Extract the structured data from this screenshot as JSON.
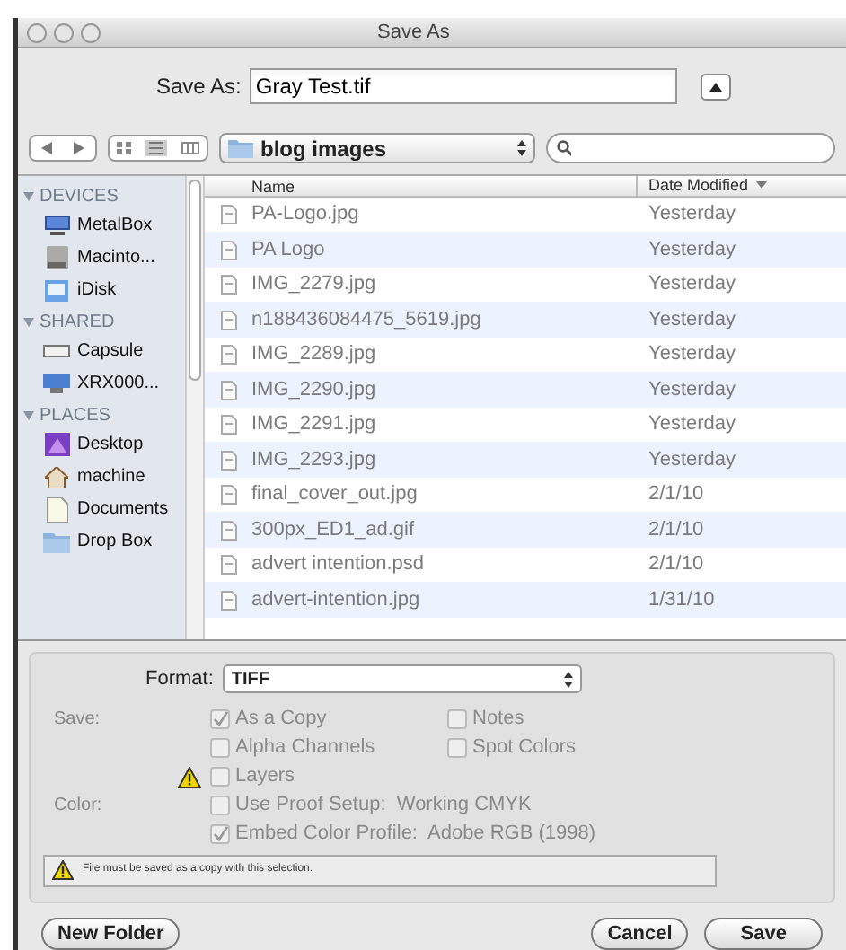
{
  "window": {
    "title": "Save As"
  },
  "save_as": {
    "label": "Save As:",
    "value": "Gray Test.tif",
    "expanded": false
  },
  "toolbar": {
    "location": "blog images"
  },
  "sidebar": [
    {
      "heading": "DEVICES",
      "expanded": true,
      "items": [
        {
          "label": "MetalBox"
        },
        {
          "label": "Macinto..."
        },
        {
          "label": "iDisk"
        }
      ]
    },
    {
      "heading": "SHARED",
      "expanded": true,
      "items": [
        {
          "label": "Capsule"
        },
        {
          "label": "XRX000..."
        }
      ]
    },
    {
      "heading": "PLACES",
      "expanded": true,
      "items": [
        {
          "label": "Desktop"
        },
        {
          "label": "machine"
        },
        {
          "label": "Documents"
        },
        {
          "label": "Drop Box"
        }
      ]
    }
  ],
  "table": {
    "columns": [
      "Name",
      "Date Modified"
    ],
    "rows": [
      {
        "name": "PA-Logo.jpg",
        "date": "Yesterday"
      },
      {
        "name": "PA Logo",
        "date": "Yesterday"
      },
      {
        "name": "IMG_2279.jpg",
        "date": "Yesterday"
      },
      {
        "name": "n188436084475_5619.jpg",
        "date": "Yesterday"
      },
      {
        "name": "IMG_2289.jpg",
        "date": "Yesterday"
      },
      {
        "name": "IMG_2290.jpg",
        "date": "Yesterday"
      },
      {
        "name": "IMG_2291.jpg",
        "date": "Yesterday"
      },
      {
        "name": "IMG_2293.jpg",
        "date": "Yesterday"
      },
      {
        "name": "final_cover_out.jpg",
        "date": "2/1/10"
      },
      {
        "name": "300px_ED1_ad.gif",
        "date": "2/1/10"
      },
      {
        "name": "advert intention.psd",
        "date": "2/1/10"
      },
      {
        "name": "advert-intention.jpg",
        "date": "1/31/10"
      }
    ]
  },
  "format": {
    "label": "Format:",
    "value": "TIFF"
  },
  "save_options": {
    "label": "Save:",
    "rows": [
      [
        {
          "label": "As a Copy",
          "checked": true,
          "warning": false
        },
        {
          "label": "Notes",
          "checked": false,
          "warning": false
        }
      ],
      [
        {
          "label": "Alpha Channels",
          "checked": false,
          "warning": false
        },
        {
          "label": "Spot Colors",
          "checked": false,
          "warning": false
        }
      ],
      [
        {
          "label": "Layers",
          "checked": false,
          "warning": true
        }
      ]
    ]
  },
  "color_options": {
    "label": "Color:",
    "rows": [
      [
        {
          "label": "Use Proof Setup:  Working CMYK",
          "checked": false,
          "warning": false
        }
      ],
      [
        {
          "label": "Embed Color Profile:  Adobe RGB (1998)",
          "checked": true,
          "warning": false
        }
      ]
    ]
  },
  "message": "File must be saved as a copy with this selection.",
  "buttons": [
    {
      "label": "New Folder",
      "kind": "left"
    },
    {
      "label": "Cancel",
      "kind": "right"
    },
    {
      "label": "Save",
      "kind": "right"
    }
  ]
}
